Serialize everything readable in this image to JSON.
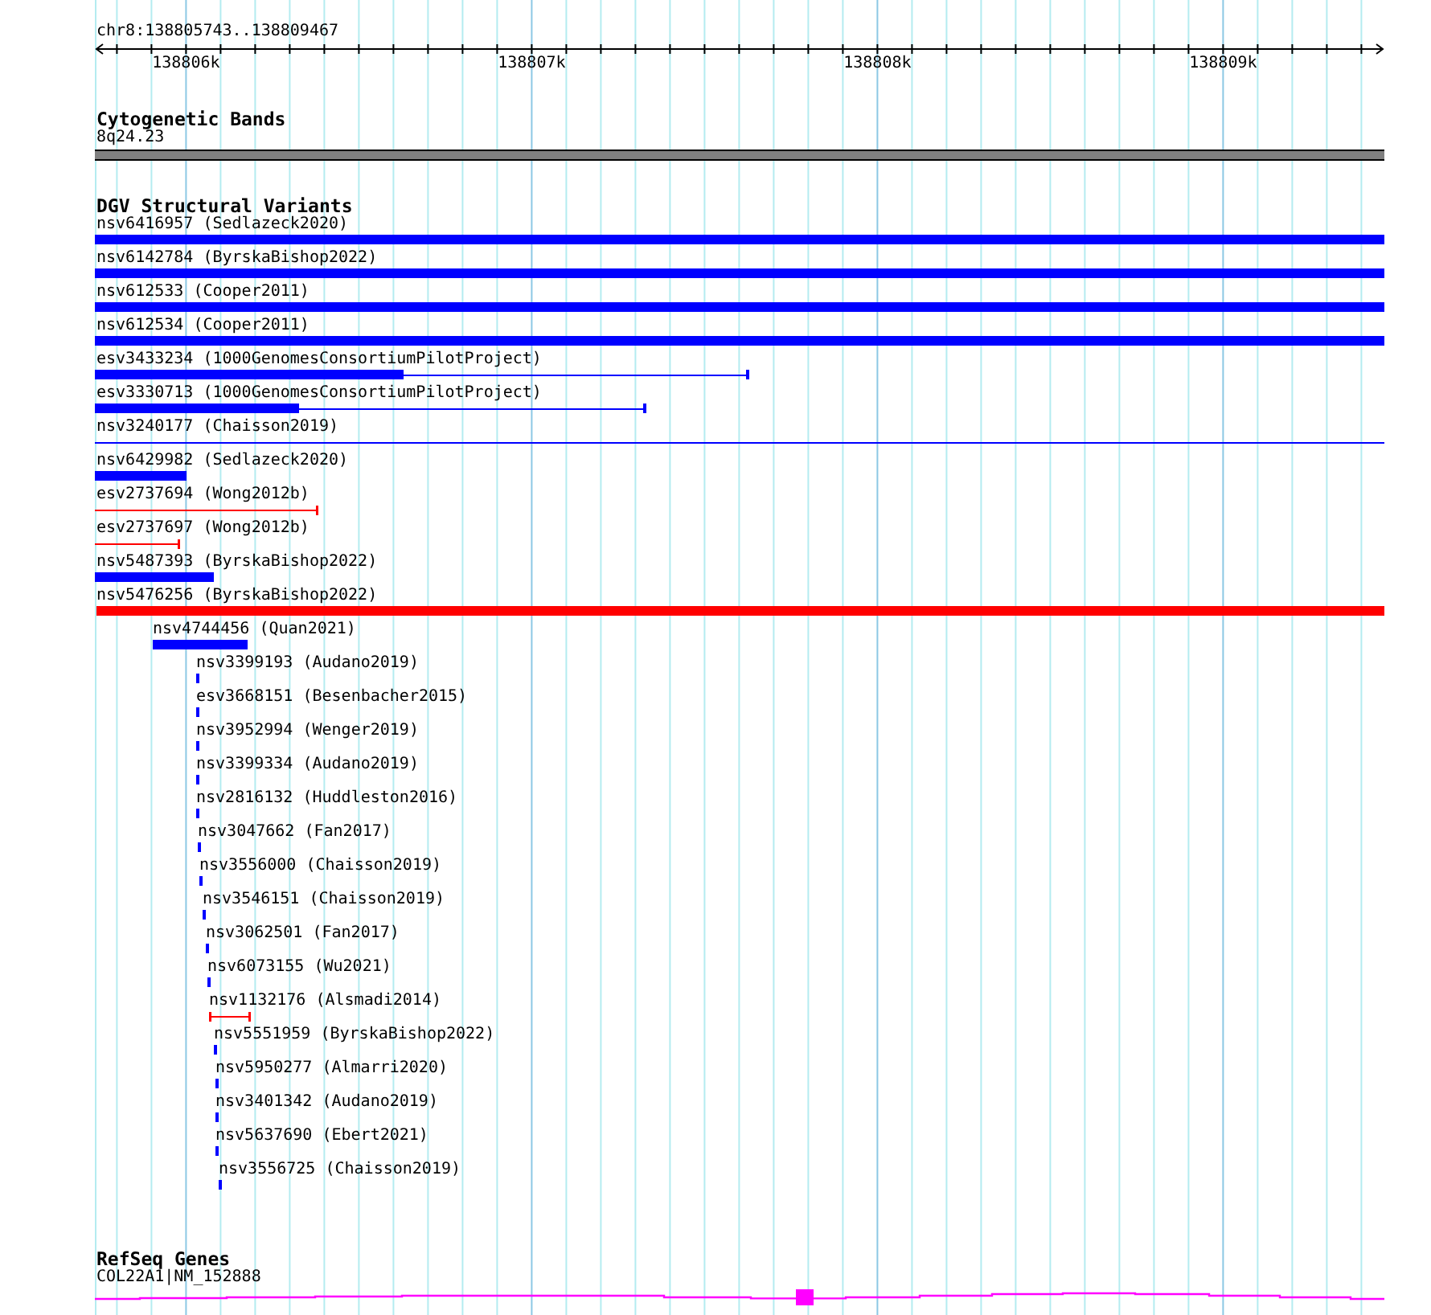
{
  "ruler": {
    "location": "chr8:138805743..138809467",
    "ticks": [
      "138806k",
      "138807k",
      "138808k",
      "138809k"
    ]
  },
  "cytobands": {
    "title": "Cytogenetic Bands",
    "label": "8q24.23"
  },
  "variants": {
    "title": "DGV Structural Variants",
    "features": [
      {
        "label": "nsv6416957 (Sedlazeck2020)",
        "kind": "bar",
        "color": "#0000ff"
      },
      {
        "label": "nsv6142784 (ByrskaBishop2022)",
        "kind": "bar",
        "color": "#0000ff"
      },
      {
        "label": "nsv612533 (Cooper2011)",
        "kind": "bar",
        "color": "#0000ff"
      },
      {
        "label": "nsv612534 (Cooper2011)",
        "kind": "bar",
        "color": "#0000ff"
      },
      {
        "label": "esv3433234 (1000GenomesConsortiumPilotProject)",
        "kind": "bar-line",
        "color": "#0000ff"
      },
      {
        "label": "esv3330713 (1000GenomesConsortiumPilotProject)",
        "kind": "bar-line",
        "color": "#0000ff"
      },
      {
        "label": "nsv3240177 (Chaisson2019)",
        "kind": "line",
        "color": "#0000ff"
      },
      {
        "label": "nsv6429982 (Sedlazeck2020)",
        "kind": "bar",
        "color": "#0000ff"
      },
      {
        "label": "esv2737694 (Wong2012b)",
        "kind": "capped-line",
        "color": "#ff0000"
      },
      {
        "label": "esv2737697 (Wong2012b)",
        "kind": "capped-line",
        "color": "#ff0000"
      },
      {
        "label": "nsv5487393 (ByrskaBishop2022)",
        "kind": "bar",
        "color": "#0000ff"
      },
      {
        "label": "nsv5476256 (ByrskaBishop2022)",
        "kind": "bar",
        "color": "#ff0000"
      },
      {
        "label": "nsv4744456 (Quan2021)",
        "kind": "bar",
        "color": "#0000ff"
      },
      {
        "label": "nsv3399193 (Audano2019)",
        "kind": "tick",
        "color": "#0000ff"
      },
      {
        "label": "esv3668151 (Besenbacher2015)",
        "kind": "tick",
        "color": "#0000ff"
      },
      {
        "label": "nsv3952994 (Wenger2019)",
        "kind": "tick",
        "color": "#0000ff"
      },
      {
        "label": "nsv3399334 (Audano2019)",
        "kind": "tick",
        "color": "#0000ff"
      },
      {
        "label": "nsv2816132 (Huddleston2016)",
        "kind": "tick",
        "color": "#0000ff"
      },
      {
        "label": "nsv3047662 (Fan2017)",
        "kind": "tick",
        "color": "#0000ff"
      },
      {
        "label": "nsv3556000 (Chaisson2019)",
        "kind": "tick",
        "color": "#0000ff"
      },
      {
        "label": "nsv3546151 (Chaisson2019)",
        "kind": "tick",
        "color": "#0000ff"
      },
      {
        "label": "nsv3062501 (Fan2017)",
        "kind": "tick",
        "color": "#0000ff"
      },
      {
        "label": "nsv6073155 (Wu2021)",
        "kind": "tick",
        "color": "#0000ff"
      },
      {
        "label": "nsv1132176 (Alsmadi2014)",
        "kind": "capped-line",
        "color": "#ff0000"
      },
      {
        "label": "nsv5551959 (ByrskaBishop2022)",
        "kind": "tick",
        "color": "#0000ff"
      },
      {
        "label": "nsv5950277 (Almarri2020)",
        "kind": "tick",
        "color": "#0000ff"
      },
      {
        "label": "nsv3401342 (Audano2019)",
        "kind": "tick",
        "color": "#0000ff"
      },
      {
        "label": "nsv5637690 (Ebert2021)",
        "kind": "tick",
        "color": "#0000ff"
      },
      {
        "label": "nsv3556725 (Chaisson2019)",
        "kind": "tick",
        "color": "#0000ff"
      }
    ]
  },
  "genes": {
    "title": "RefSeq Genes",
    "label": "COL22A1|NM_152888"
  }
}
